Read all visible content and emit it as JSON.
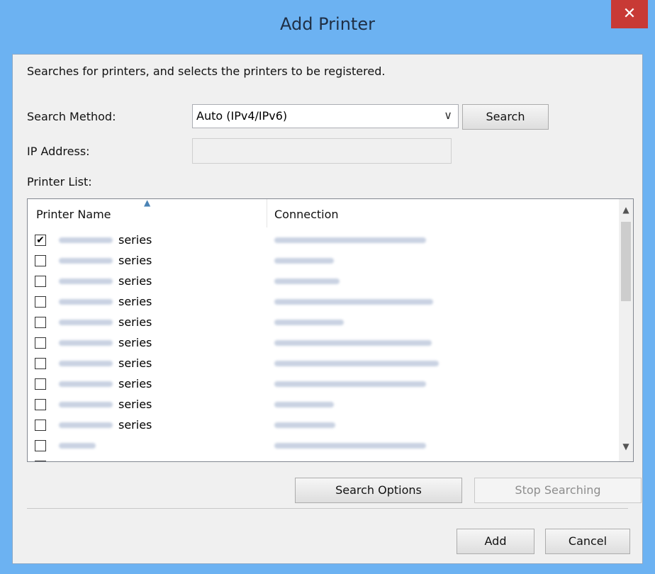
{
  "window": {
    "title": "Add Printer",
    "close_glyph": "✕"
  },
  "description": "Searches for printers, and selects the printers to be registered.",
  "search_method": {
    "label": "Search Method:",
    "value": "Auto (IPv4/IPv6)",
    "dropdown_glyph": "∨"
  },
  "search_button": "Search",
  "ip_address": {
    "label": "IP Address:",
    "value": ""
  },
  "printer_list": {
    "label": "Printer List:",
    "columns": [
      "Printer Name",
      "Connection"
    ],
    "rows": [
      {
        "checked": true,
        "suffix": "series"
      },
      {
        "checked": false,
        "suffix": "series"
      },
      {
        "checked": false,
        "suffix": "series"
      },
      {
        "checked": false,
        "suffix": "series"
      },
      {
        "checked": false,
        "suffix": "series"
      },
      {
        "checked": false,
        "suffix": "series"
      },
      {
        "checked": false,
        "suffix": "series"
      },
      {
        "checked": false,
        "suffix": "series"
      },
      {
        "checked": false,
        "suffix": "series"
      },
      {
        "checked": false,
        "suffix": "series"
      },
      {
        "checked": false,
        "suffix": ""
      },
      {
        "checked": false,
        "suffix": ""
      }
    ]
  },
  "buttons": {
    "search_options": "Search Options",
    "stop_searching": "Stop Searching",
    "add": "Add",
    "cancel": "Cancel"
  },
  "colors": {
    "titlebar": "#6cb2f2",
    "close": "#c83a35"
  }
}
